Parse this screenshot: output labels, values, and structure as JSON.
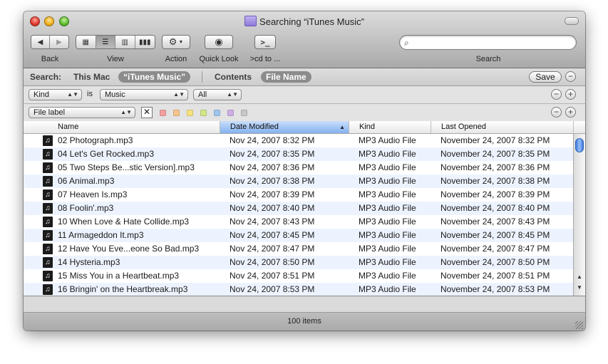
{
  "window": {
    "title": "Searching “iTunes Music”"
  },
  "toolbar": {
    "back_label": "Back",
    "view_label": "View",
    "action_label": "Action",
    "quicklook_label": "Quick Look",
    "cd_label": ">cd to ...",
    "cd_button_glyph": ">_",
    "search_label": "Search",
    "search_value": ""
  },
  "scope": {
    "search_label": "Search:",
    "this_mac": "This Mac",
    "itunes_music": "“iTunes Music”",
    "contents": "Contents",
    "file_name": "File Name",
    "save_label": "Save"
  },
  "criteria1": {
    "attribute": "Kind",
    "is_word": "is",
    "value": "Music",
    "extra": "All"
  },
  "criteria2": {
    "attribute": "File label",
    "clear_glyph": "✕"
  },
  "label_colors": [
    "#f4a0a0",
    "#f6c48a",
    "#f5e27c",
    "#d0e786",
    "#9fc5ef",
    "#cfaee6",
    "#c8c8c8"
  ],
  "columns": {
    "name": "Name",
    "date_modified": "Date Modified",
    "kind": "Kind",
    "last_opened": "Last Opened"
  },
  "files": [
    {
      "name": "02 Photograph.mp3",
      "modified": "Nov 24, 2007 8:32 PM",
      "kind": "MP3 Audio File",
      "opened": "November 24, 2007 8:32 PM"
    },
    {
      "name": "04 Let's Get Rocked.mp3",
      "modified": "Nov 24, 2007 8:35 PM",
      "kind": "MP3 Audio File",
      "opened": "November 24, 2007 8:35 PM"
    },
    {
      "name": "05 Two Steps Be...stic Version].mp3",
      "modified": "Nov 24, 2007 8:36 PM",
      "kind": "MP3 Audio File",
      "opened": "November 24, 2007 8:36 PM"
    },
    {
      "name": "06 Animal.mp3",
      "modified": "Nov 24, 2007 8:38 PM",
      "kind": "MP3 Audio File",
      "opened": "November 24, 2007 8:38 PM"
    },
    {
      "name": "07 Heaven Is.mp3",
      "modified": "Nov 24, 2007 8:39 PM",
      "kind": "MP3 Audio File",
      "opened": "November 24, 2007 8:39 PM"
    },
    {
      "name": "08 Foolin'.mp3",
      "modified": "Nov 24, 2007 8:40 PM",
      "kind": "MP3 Audio File",
      "opened": "November 24, 2007 8:40 PM"
    },
    {
      "name": "10 When Love & Hate Collide.mp3",
      "modified": "Nov 24, 2007 8:43 PM",
      "kind": "MP3 Audio File",
      "opened": "November 24, 2007 8:43 PM"
    },
    {
      "name": "11 Armageddon It.mp3",
      "modified": "Nov 24, 2007 8:45 PM",
      "kind": "MP3 Audio File",
      "opened": "November 24, 2007 8:45 PM"
    },
    {
      "name": "12 Have You Eve...eone So Bad.mp3",
      "modified": "Nov 24, 2007 8:47 PM",
      "kind": "MP3 Audio File",
      "opened": "November 24, 2007 8:47 PM"
    },
    {
      "name": "14 Hysteria.mp3",
      "modified": "Nov 24, 2007 8:50 PM",
      "kind": "MP3 Audio File",
      "opened": "November 24, 2007 8:50 PM"
    },
    {
      "name": "15 Miss You in a Heartbeat.mp3",
      "modified": "Nov 24, 2007 8:51 PM",
      "kind": "MP3 Audio File",
      "opened": "November 24, 2007 8:51 PM"
    },
    {
      "name": "16 Bringin' on the Heartbreak.mp3",
      "modified": "Nov 24, 2007 8:53 PM",
      "kind": "MP3 Audio File",
      "opened": "November 24, 2007 8:53 PM"
    }
  ],
  "status": {
    "items": "100 items"
  }
}
